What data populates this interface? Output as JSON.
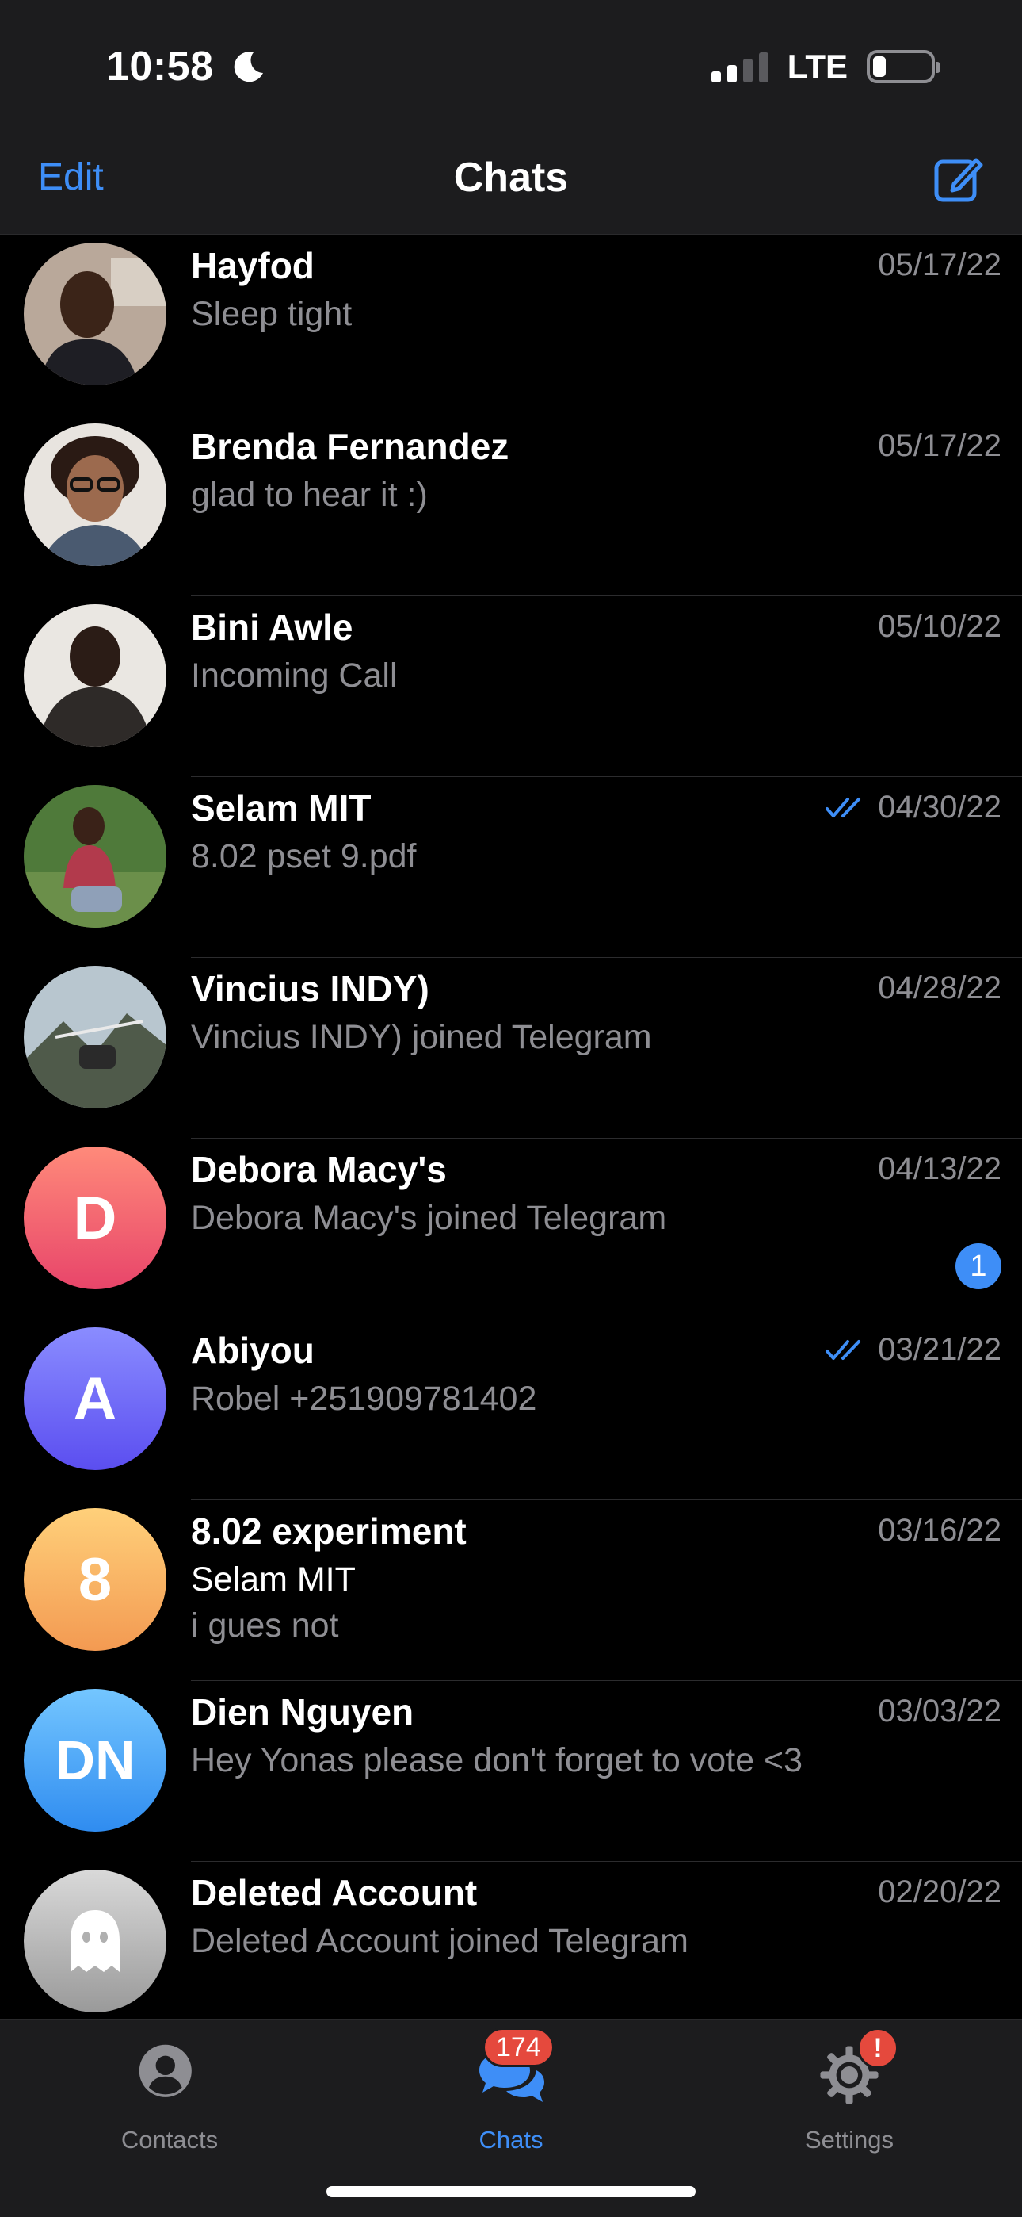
{
  "status": {
    "time": "10:58",
    "network": "LTE"
  },
  "nav": {
    "edit_label": "Edit",
    "title": "Chats"
  },
  "chats": [
    {
      "name": "Hayfod",
      "date": "05/17/22",
      "preview": "Sleep tight",
      "read": false
    },
    {
      "name": "Brenda Fernandez",
      "date": "05/17/22",
      "preview": "glad to hear it :)",
      "read": false
    },
    {
      "name": "Bini Awle",
      "date": "05/10/22",
      "preview": "Incoming Call",
      "read": false
    },
    {
      "name": "Selam MIT",
      "date": "04/30/22",
      "preview": "8.02 pset 9.pdf",
      "read": true
    },
    {
      "name": "Vincius INDY)",
      "date": "04/28/22",
      "preview": "Vincius INDY) joined Telegram",
      "read": false
    },
    {
      "name": "Debora Macy's",
      "date": "04/13/22",
      "preview": "Debora Macy's joined Telegram",
      "initials": "D",
      "unread": "1",
      "read": false
    },
    {
      "name": "Abiyou",
      "date": "03/21/22",
      "preview": "Robel +251909781402",
      "initials": "A",
      "read": true
    },
    {
      "name": "8.02 experiment",
      "date": "03/16/22",
      "sender": "Selam MIT",
      "preview": "i gues not",
      "initials": "8",
      "read": false
    },
    {
      "name": "Dien Nguyen",
      "date": "03/03/22",
      "preview": "Hey Yonas please don't forget to vote <3",
      "initials": "DN",
      "read": false
    },
    {
      "name": "Deleted Account",
      "date": "02/20/22",
      "preview": "Deleted Account joined Telegram",
      "read": false
    }
  ],
  "tabs": {
    "contacts": {
      "label": "Contacts"
    },
    "chats": {
      "label": "Chats",
      "badge": "174"
    },
    "settings": {
      "label": "Settings",
      "badge": "!"
    }
  },
  "colors": {
    "accent": "#3e8ef7",
    "badge": "#e5493d",
    "avatar_d": [
      "#ff8a7a",
      "#e8456a"
    ],
    "avatar_a": [
      "#8a8cff",
      "#5b4ef0"
    ],
    "avatar_8": [
      "#ffd07a",
      "#f39a52"
    ],
    "avatar_dn": [
      "#74c6ff",
      "#2f8cf0"
    ],
    "avatar_deleted": [
      "#d9d9d9",
      "#9a9a9a"
    ]
  }
}
